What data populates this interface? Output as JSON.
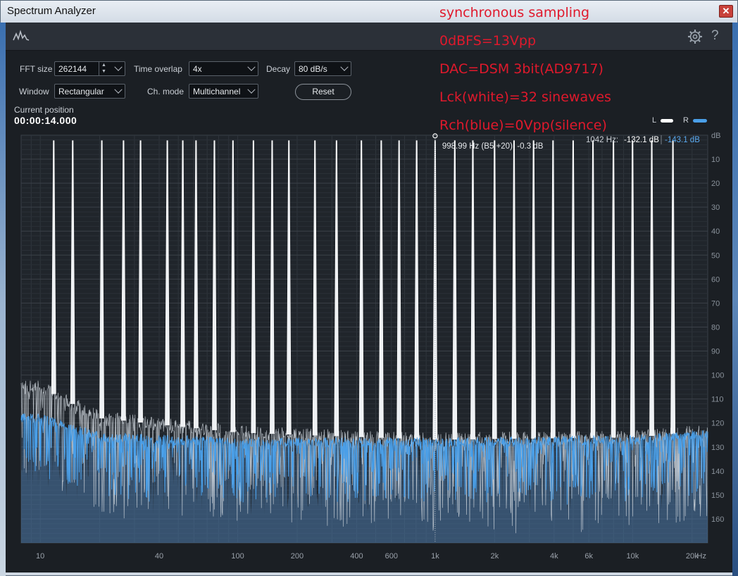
{
  "window": {
    "title": "Spectrum Analyzer"
  },
  "controls": {
    "fft_size_label": "FFT size",
    "fft_size_value": "262144",
    "time_overlap_label": "Time overlap",
    "time_overlap_value": "4x",
    "decay_label": "Decay",
    "decay_value": "80 dB/s",
    "window_label": "Window",
    "window_value": "Rectangular",
    "chmode_label": "Ch. mode",
    "chmode_value": "Multichannel",
    "reset_label": "Reset"
  },
  "position": {
    "label": "Current position",
    "value": "00:00:14.000"
  },
  "legend": {
    "l": "L",
    "r": "R",
    "l_color": "#ffffff",
    "r_color": "#4a9fe8"
  },
  "readout": {
    "prefix": "1042 Hz:",
    "l_value": "-132.1 dB",
    "r_value": "-143.1 dB"
  },
  "cursor": {
    "label": "998.99 Hz (B5 +20), -0.3 dB",
    "freq": 998.99,
    "db": -0.3
  },
  "annotations": [
    "synchronous sampling",
    "0dBFS=13Vpp",
    "DAC=DSM 3bit(AD9717)",
    "Lck(white)=32 sinewaves",
    "Rch(blue)=0Vpp(silence)"
  ],
  "chart_data": {
    "type": "line",
    "x_scale": "log",
    "xlim": [
      8,
      24000
    ],
    "ylim": [
      0,
      170
    ],
    "y_axis_unit": "dB",
    "x_axis_unit": "Hz",
    "x_ticks": [
      10,
      40,
      100,
      200,
      400,
      600,
      1000,
      2000,
      4000,
      6000,
      10000,
      20000
    ],
    "x_tick_labels": [
      "10",
      "40",
      "100",
      "200",
      "400",
      "600",
      "1k",
      "2k",
      "4k",
      "6k",
      "10k",
      "20k"
    ],
    "y_ticks": [
      10,
      20,
      30,
      40,
      50,
      60,
      70,
      80,
      90,
      100,
      110,
      120,
      130,
      140,
      150,
      160
    ],
    "grid": true,
    "legend_position": "top-right",
    "series": [
      {
        "name": "L",
        "color": "#ffffff",
        "peaks_hz": [
          11.7,
          14.6,
          20.5,
          26.4,
          32.2,
          44.0,
          52.7,
          61.5,
          76.2,
          94.6,
          120.1,
          149.4,
          181.6,
          246.1,
          316.4,
          422.9,
          533.2,
          656.3,
          805.7,
          998.99,
          1256.8,
          1551.6,
          1998.6,
          2508.1,
          3149.4,
          3952.1,
          4997.3,
          6297.4,
          7992.8,
          9988.5,
          12498.7,
          15999.4
        ],
        "peak_db": 0.3,
        "noise_floor_db": [
          [
            10,
            105
          ],
          [
            20,
            118
          ],
          [
            100,
            124
          ],
          [
            1000,
            127
          ],
          [
            10000,
            126
          ],
          [
            20000,
            124
          ]
        ]
      },
      {
        "name": "R",
        "color": "#4a9fe8",
        "noise_floor_db": [
          [
            10,
            118
          ],
          [
            20,
            126
          ],
          [
            100,
            128
          ],
          [
            1000,
            128
          ],
          [
            10000,
            127
          ],
          [
            20000,
            125
          ]
        ]
      }
    ]
  }
}
